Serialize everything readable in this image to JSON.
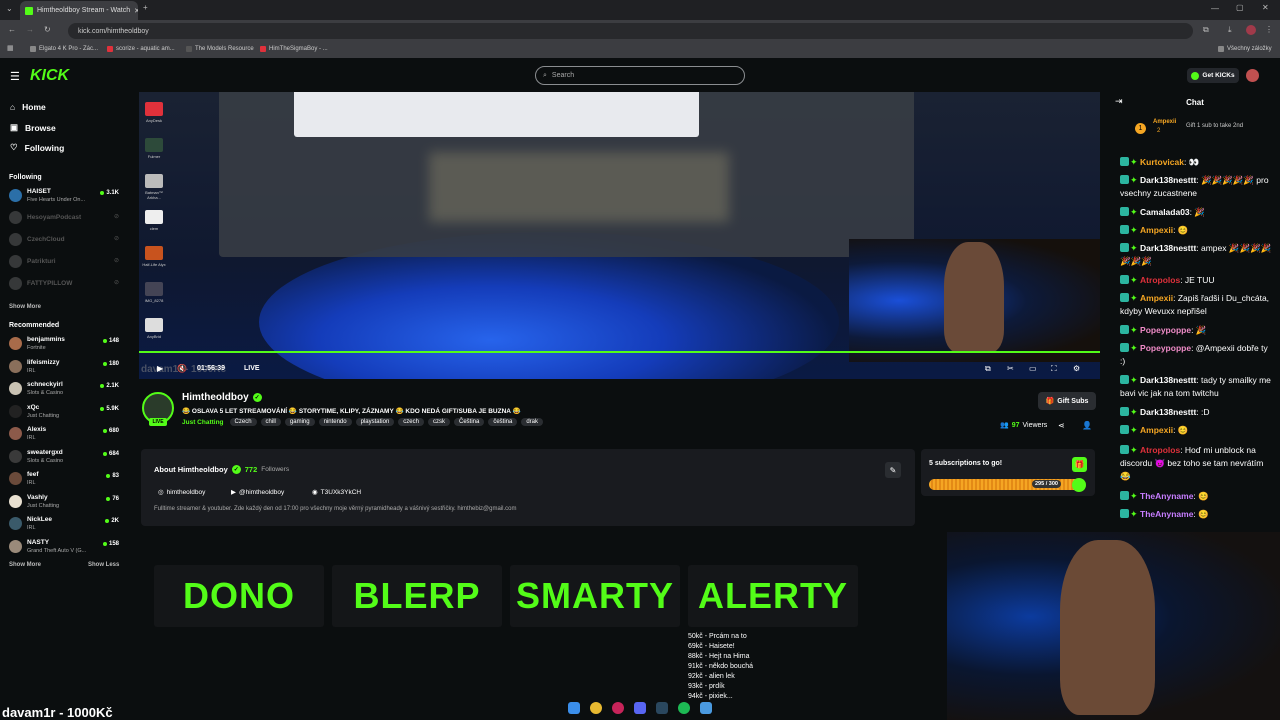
{
  "browser": {
    "tab_title": "Himtheoldboy Stream - Watch",
    "url": "kick.com/himtheoldboy",
    "bookmarks": [
      "Elgato 4 K Pro - Zác...",
      "scorize - aquatic am...",
      "The Models Resource",
      "HimTheSigmaBoy - ..."
    ],
    "all_bookmarks": "Všechny záložky"
  },
  "header": {
    "logo": "KICK",
    "search_placeholder": "Search",
    "get_kicks": "Get KICKs"
  },
  "sidebar": {
    "nav": [
      {
        "label": "Home"
      },
      {
        "label": "Browse"
      },
      {
        "label": "Following"
      }
    ],
    "following_title": "Following",
    "following": [
      {
        "name": "HAISET",
        "category": "Five Hearts Under On...",
        "viewers": "3.1K",
        "live": true,
        "color": "#2b6fa8"
      },
      {
        "name": "HesoyamPodcast",
        "category": "",
        "viewers": "",
        "live": false,
        "color": "#777"
      },
      {
        "name": "CzechCloud",
        "category": "",
        "viewers": "",
        "live": false,
        "color": "#777"
      },
      {
        "name": "Patrikturi",
        "category": "",
        "viewers": "",
        "live": false,
        "color": "#777"
      },
      {
        "name": "FATTYPILLOW",
        "category": "",
        "viewers": "",
        "live": false,
        "color": "#777"
      }
    ],
    "show_more": "Show More",
    "recommended_title": "Recommended",
    "recommended": [
      {
        "name": "benjammins",
        "category": "Fortnite",
        "viewers": "148",
        "color": "#a86b4a"
      },
      {
        "name": "lifeismizzy",
        "category": "IRL",
        "viewers": "180",
        "color": "#8a6f5b"
      },
      {
        "name": "schneckyirl",
        "category": "Slots & Casino",
        "viewers": "2.1K",
        "color": "#c9c2b3"
      },
      {
        "name": "xQc",
        "category": "Just Chatting",
        "viewers": "5.9K",
        "color": "#222"
      },
      {
        "name": "Alexis",
        "category": "IRL",
        "viewers": "680",
        "color": "#8c5a4a"
      },
      {
        "name": "sweatergxd",
        "category": "Slots & Casino",
        "viewers": "684",
        "color": "#3a3a3a"
      },
      {
        "name": "feef",
        "category": "IRL",
        "viewers": "83",
        "color": "#6a4a3a"
      },
      {
        "name": "Vashly",
        "category": "Just Chatting",
        "viewers": "76",
        "color": "#e8e0d0"
      },
      {
        "name": "NickLee",
        "category": "IRL",
        "viewers": "2K",
        "color": "#3a5a6a"
      },
      {
        "name": "NASTY",
        "category": "Grand Theft Auto V (G...",
        "viewers": "158",
        "color": "#9a8a7a"
      }
    ],
    "show_more_2": "Show More",
    "show_less": "Show Less"
  },
  "player": {
    "time": "01:56:39",
    "live": "LIVE",
    "overlay_text": "davam1r - 1000Kč",
    "desktop_icons": [
      {
        "label": "AnyDesk",
        "color": "#e0313b"
      },
      {
        "label": "Fulmer",
        "color": "#2d4a3a"
      },
      {
        "label": "Batman™ Arkha...",
        "color": "#bbb"
      },
      {
        "label": "clem",
        "color": "#eee"
      },
      {
        "label": "Half-Life Alyx",
        "color": "#c8531e"
      },
      {
        "label": "IMG_8278",
        "color": "#445"
      },
      {
        "label": "AnyBrid",
        "color": "#ddd"
      }
    ]
  },
  "stream": {
    "channel": "Himtheoldboy",
    "title": "😂 OSLAVA 5 LET STREAMOVÁNÍ 😂 STORYTIME, KLIPY, ZÁZNAMY 😂 KDO NEDÁ GIFT/SUBA JE BUZNA 😂",
    "category": "Just Chatting",
    "tags": [
      "Czech",
      "chill",
      "gaming",
      "nintendo",
      "playstation",
      "czech",
      "czsk",
      "Čeština",
      "čeština",
      "drak"
    ],
    "live_badge": "LIVE",
    "gift_subs": "Gift Subs",
    "viewers": "97",
    "viewers_label": "Viewers"
  },
  "about": {
    "title": "About Himtheoldboy",
    "followers": "772",
    "followers_label": "Followers",
    "instagram": "himtheoldboy",
    "youtube": "@himtheoldboy",
    "discord": "T3UXk3YkCH",
    "bio": "Fulltime streamer & youtuber. Zde každý den od 17:00 pro všechny moje věrný pyramidheady a vášnivý sestřičky. himthebiz@gmail.com"
  },
  "subs_goal": {
    "title": "5 subscriptions to go!",
    "count": "295 / 300",
    "progress": 0.983
  },
  "panels": [
    "DONO",
    "BLERP",
    "SMARTY",
    "ALERTY"
  ],
  "price_list": [
    "50kč - Prcám na to",
    "69kč - Haisete!",
    "88kč - Hejt na Hima",
    "91kč - někdo bouchá",
    "92kč - alien lek",
    "93kč - prdík",
    "94kč - pixiek..."
  ],
  "chat": {
    "title": "Chat",
    "pinned_user": "Ampexii",
    "pinned_count": "2",
    "pinned_text": "Gift 1 sub to take 2nd",
    "messages": [
      {
        "user": "Kurtovicak",
        "text": "👀",
        "color": "#f5a623"
      },
      {
        "user": "Dark138nesttt",
        "text": "🎉🎉🎉🎉🎉 pro vsechny zucastnene",
        "color": "#ffffff"
      },
      {
        "user": "Camalada03",
        "text": "🎉",
        "color": "#ffffff"
      },
      {
        "user": "Ampexii",
        "text": "😊",
        "color": "#f5a623"
      },
      {
        "user": "Dark138nesttt",
        "text": "ampex 🎉🎉🎉🎉🎉🎉🎉",
        "color": "#ffffff"
      },
      {
        "user": "Atropolos",
        "text": "JE TUU",
        "color": "#e0313b"
      },
      {
        "user": "Ampexii",
        "text": "Zapiš řadši i Du_chcáta, kdyby Wevuxx nepřišel",
        "color": "#f5a623"
      },
      {
        "user": "Popeypoppe",
        "text": "🎉",
        "color": "#f08cc8"
      },
      {
        "user": "Popeypoppe",
        "text": "@Ampexii dobře ty :)",
        "color": "#f08cc8"
      },
      {
        "user": "Dark138nesttt",
        "text": "tady ty smailky me bavi vic jak na tom twitchu",
        "color": "#ffffff"
      },
      {
        "user": "Dark138nesttt",
        "text": ":D",
        "color": "#ffffff"
      },
      {
        "user": "Ampexii",
        "text": "😊",
        "color": "#f5a623"
      },
      {
        "user": "Atropolos",
        "text": "Hoď mi unblock na discordu 😈 bez toho se tam nevrátím 😂",
        "color": "#e0313b"
      },
      {
        "user": "TheAnyname",
        "text": "😊",
        "color": "#c77dff"
      },
      {
        "user": "TheAnyname",
        "text": "😊",
        "color": "#c77dff"
      }
    ]
  },
  "colors": {
    "accent": "#53fc18",
    "bg": "#0b0e0f"
  }
}
